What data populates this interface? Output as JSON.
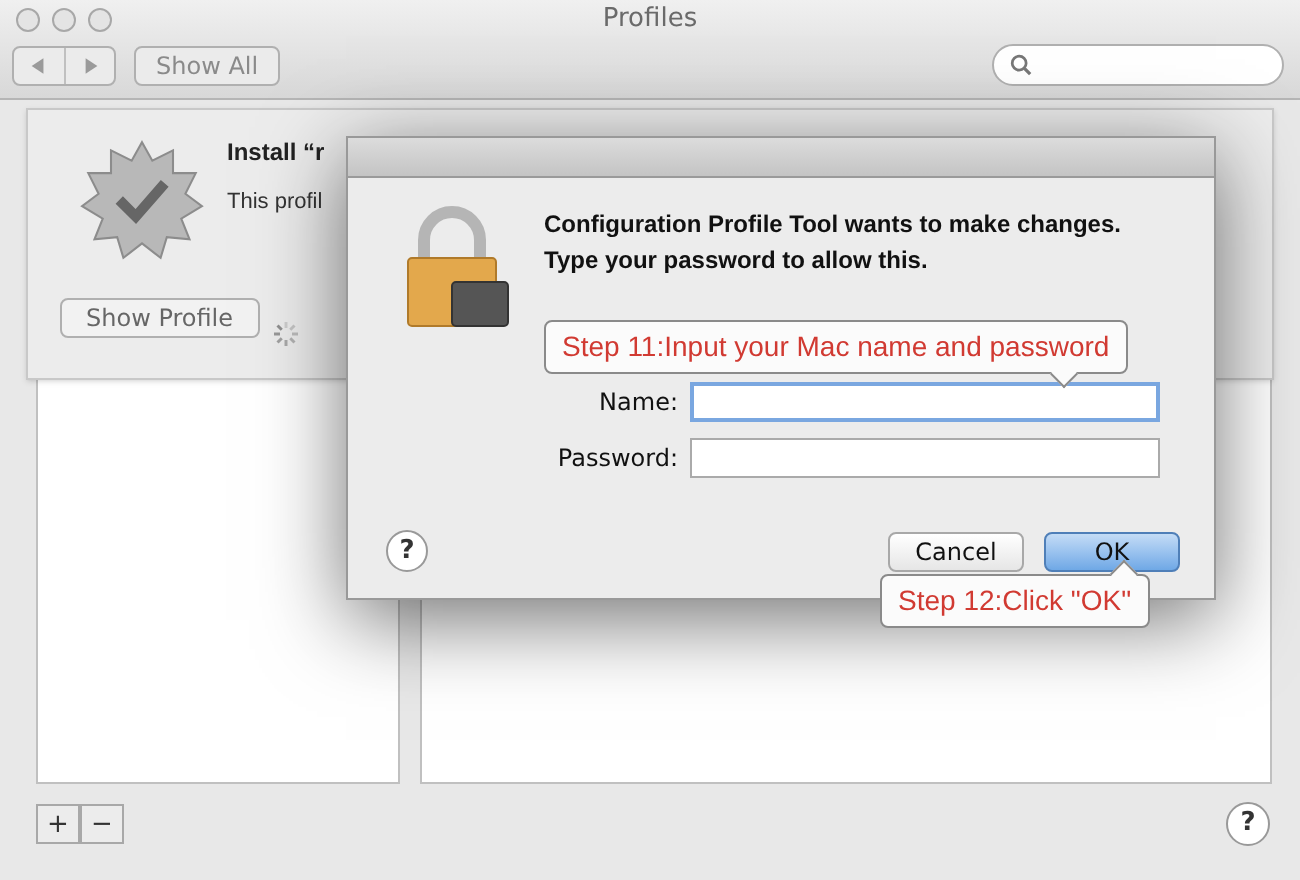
{
  "window": {
    "title": "Profiles"
  },
  "toolbar": {
    "show_all": "Show All"
  },
  "sheet": {
    "title": "Install “r",
    "subtitle": "This profil",
    "show_profile": "Show Profile"
  },
  "list_buttons": [
    "+",
    "−"
  ],
  "dialog": {
    "message": "Configuration Profile Tool wants to make changes. Type your password to allow this.",
    "fields": [
      {
        "label": "Name:",
        "focused": true
      },
      {
        "label": "Password:",
        "focused": false
      }
    ],
    "help": "?",
    "buttons": [
      {
        "label": "Cancel",
        "default": false
      },
      {
        "label": "OK",
        "default": true
      }
    ]
  },
  "callouts": [
    {
      "text": "Step 11:Input your Mac name and password"
    },
    {
      "text": "Step 12:Click \"OK\""
    }
  ],
  "help": "?"
}
